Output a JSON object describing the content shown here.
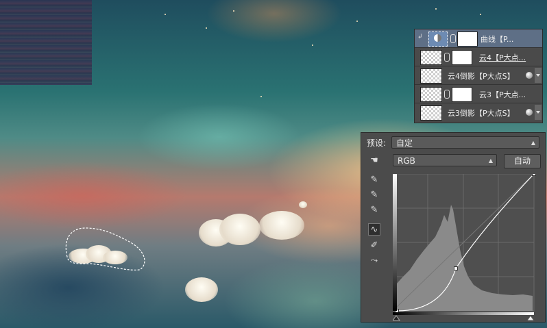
{
  "layers_panel": {
    "rows": [
      {
        "name": "曲线【P...",
        "type": "adjustment",
        "selected": true,
        "clipped": true
      },
      {
        "name": "云4【P大点...",
        "type": "masked"
      },
      {
        "name": "云4倒影【P大点S】",
        "type": "smart",
        "fx": true
      },
      {
        "name": "云3【P大点...",
        "type": "masked"
      },
      {
        "name": "云3倒影【P大点S】",
        "type": "smart",
        "fx": true
      }
    ]
  },
  "curves": {
    "preset_label": "预设:",
    "preset_value": "自定",
    "channel_value": "RGB",
    "auto_button": "自动",
    "control_points": [
      [
        0,
        0
      ],
      [
        0.43,
        0.31
      ],
      [
        1,
        1
      ]
    ],
    "tools": [
      "hand-adjust-icon",
      "black-eyedropper-icon",
      "gray-eyedropper-icon",
      "white-eyedropper-icon",
      "curve-point-icon",
      "pencil-icon",
      "smooth-icon"
    ]
  },
  "colors": {
    "panel_bg": "#4b4b4b",
    "selected_layer": "#5e6f86",
    "histogram": "#8a8a8a",
    "curve": "#ffffff"
  }
}
